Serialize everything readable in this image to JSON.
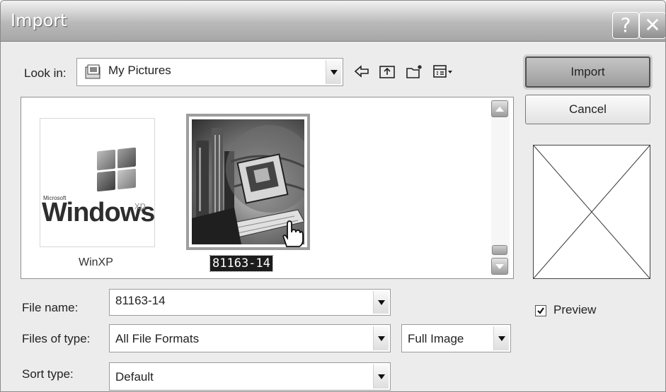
{
  "dialog": {
    "title": "Import",
    "help_glyph": "?",
    "close_glyph": "✕"
  },
  "look_in": {
    "label": "Look in:",
    "value": "My Pictures"
  },
  "toolbar": {
    "icons": [
      "back-arrow-icon",
      "up-folder-icon",
      "new-folder-icon",
      "view-menu-icon"
    ]
  },
  "files": [
    {
      "name": "WinXP",
      "logo_small": "Microsoft",
      "logo_text": "Windows",
      "logo_sup": "xp"
    },
    {
      "name": "81163-14",
      "selected": true
    }
  ],
  "buttons": {
    "import": "Import",
    "cancel": "Cancel"
  },
  "preview": {
    "label": "Preview",
    "checked": true
  },
  "form": {
    "file_name_label": "File name:",
    "file_name_value": "81163-14",
    "file_type_label": "Files of type:",
    "file_type_value": "All File Formats",
    "image_mode_value": "Full Image",
    "sort_label": "Sort type:",
    "sort_value": "Default"
  },
  "colors": {
    "titlebar": "#a7a7a7",
    "selection": "#1c1c1c",
    "window_bg": "#ececec"
  }
}
